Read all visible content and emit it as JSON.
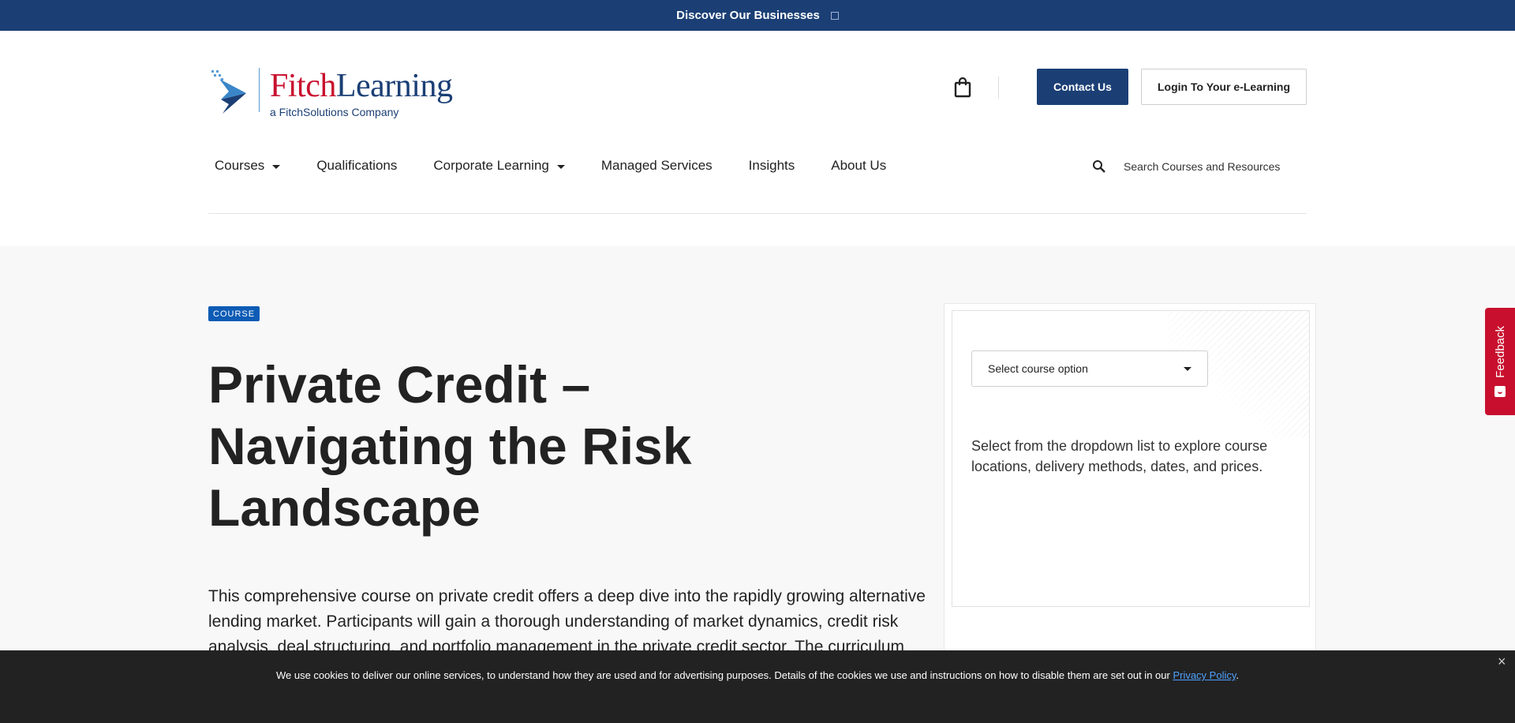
{
  "topbar": {
    "label": "Discover Our Businesses"
  },
  "header": {
    "logo": {
      "brand_part1": "Fitch",
      "brand_part2": "Learning",
      "tagline": "a FitchSolutions Company"
    },
    "cart_icon": "shopping-bag",
    "contact_label": "Contact Us",
    "login_label": "Login To Your e-Learning"
  },
  "nav": {
    "items": [
      {
        "label": "Courses",
        "has_dropdown": true
      },
      {
        "label": "Qualifications",
        "has_dropdown": false
      },
      {
        "label": "Corporate Learning",
        "has_dropdown": true
      },
      {
        "label": "Managed Services",
        "has_dropdown": false
      },
      {
        "label": "Insights",
        "has_dropdown": false
      },
      {
        "label": "About Us",
        "has_dropdown": false
      }
    ],
    "search_placeholder": "Search Courses and Resources"
  },
  "main": {
    "badge": "COURSE",
    "title": "Private Credit – Navigating the Risk Landscape",
    "description": "This comprehensive course on private credit offers a deep dive into the rapidly growing alternative lending market. Participants will gain a thorough understanding of market dynamics, credit risk analysis, deal structuring, and portfolio management in the private credit sector. The curriculum covers essential topics"
  },
  "course_card": {
    "select_label": "Select course option",
    "help_text": "Select from the dropdown list to explore course locations, delivery methods, dates, and prices."
  },
  "feedback": {
    "label": "Feedback"
  },
  "cookie": {
    "text": "We use cookies to deliver our online services, to understand how they are used and for advertising purposes. Details of the cookies we use and instructions on how to disable them are set out in our ",
    "link_label": "Privacy Policy",
    "suffix": "."
  },
  "colors": {
    "brand_navy": "#1b3f75",
    "brand_red": "#c8102e",
    "badge_blue": "#0c5bb5",
    "cookie_bg": "#222222"
  }
}
